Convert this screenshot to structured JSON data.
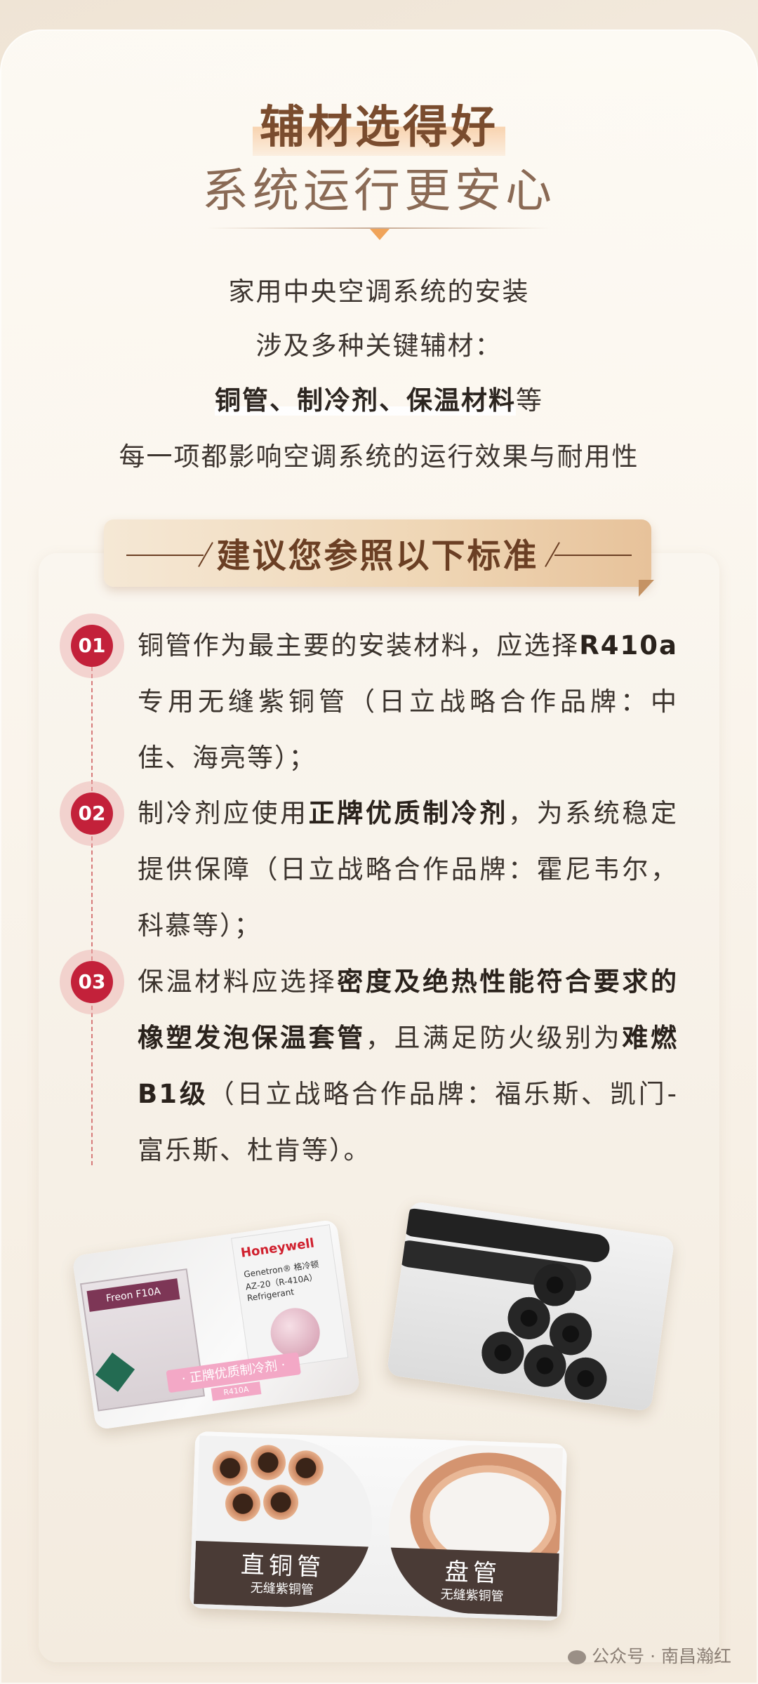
{
  "header": {
    "title_line1": "辅材选得好",
    "title_line2": "系统运行更安心"
  },
  "intro": {
    "line1": "家用中央空调系统的安装",
    "line2": "涉及多种关键辅材：",
    "line3_bold": "铜管、制冷剂、保温材料",
    "line3_tail": "等",
    "line4": "每一项都影响空调系统的运行效果与耐用性"
  },
  "ribbon": {
    "label": "建议您参照以下标准"
  },
  "items": [
    {
      "num": "01",
      "part1": "铜管作为最主要的安装材料，应选择",
      "bold1": "R410a",
      "part2": "专用无缝紫铜管（日立战略合作品牌：中佳、海亮等）；"
    },
    {
      "num": "02",
      "part1": "制冷剂应使用",
      "bold1": "正牌优质制冷剂",
      "part2": "，为系统稳定提供保障（日立战略合作品牌：霍尼韦尔，科慕等）；"
    },
    {
      "num": "03",
      "part1": "保温材料应选择",
      "bold1": "密度及绝热性能符合要求的橡塑发泡保温套管",
      "part2": "，且满足防火级别为",
      "bold2": "难燃B1级",
      "part3": "（日立战略合作品牌：福乐斯、凯门-富乐斯、杜肯等）。"
    }
  ],
  "photos": {
    "refrigerant": {
      "brand": "Honeywell",
      "product_line1": "Genetron® 格冷顿",
      "product_line2": "AZ-20（R-410A）",
      "product_line3": "Refrigerant",
      "box_label": "Freon F10A",
      "caption": "· 正牌优质制冷剂 ·",
      "caption_sub": "R410A"
    },
    "copper": {
      "straight_label": "直铜管",
      "straight_sub": "无缝紫铜管",
      "coil_label": "盘管",
      "coil_sub": "无缝紫铜管"
    }
  },
  "watermark": "公众号 · 南昌瀚红",
  "colors": {
    "title": "#7a4c2e",
    "accent_orange": "#f0a45a",
    "badge_red": "#c3213a",
    "ribbon_text": "#6b3f24"
  }
}
